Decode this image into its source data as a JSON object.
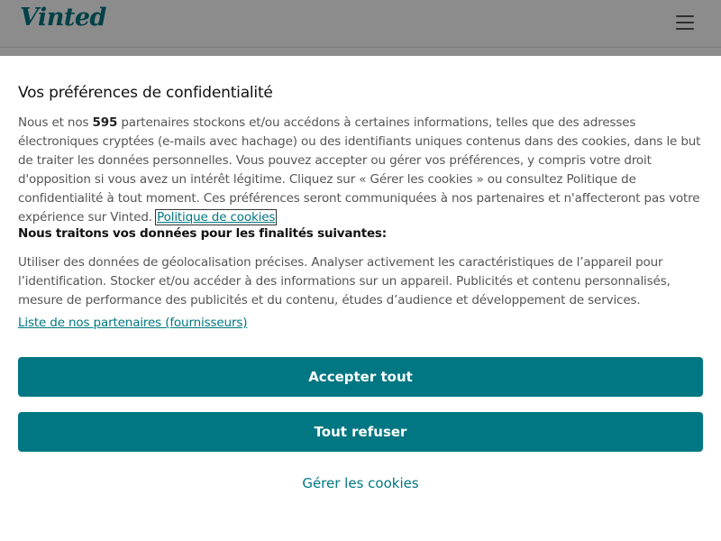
{
  "header": {
    "logo_text": "Vinted",
    "menu_icon": "hamburger-menu-icon"
  },
  "consent": {
    "title": "Vos préférences de confidentialité",
    "intro_before_count": "Nous et nos ",
    "partner_count": "595",
    "intro_after_count": " partenaires stockons et/ou accédons à certaines informations, telles que des adresses électroniques cryptées (e-mails avec hachage) ou des identifiants uniques contenus dans des cookies, dans le but de traiter les données personnelles. Vous pouvez accepter ou gérer vos préférences, y compris votre droit d'opposition si vous avez un intérêt légitime. Cliquez sur « Gérer les cookies » ou consultez Politique de confidentialité à tout moment. Ces préférences seront communiquées à nos partenaires et n'affecteront pas votre expérience sur Vinted. ",
    "policy_link": "Politique de cookies",
    "purposes_heading": "Nous traitons vos données pour les finalités suivantes:",
    "purposes_text": "Utiliser des données de géolocalisation précises. Analyser activement les caractéristiques de l’appareil pour l’identification. Stocker et/ou accéder à des informations sur un appareil. Publicités et contenu personnalisés, mesure de performance des publicités et du contenu, études d’audience et développement de services.",
    "partners_link": "Liste de nos partenaires (fournisseurs)",
    "accept_label": "Accepter tout",
    "refuse_label": "Tout refuser",
    "manage_label": "Gérer les cookies"
  },
  "colors": {
    "brand": "#007782",
    "text": "#555555",
    "heading": "#111111"
  }
}
